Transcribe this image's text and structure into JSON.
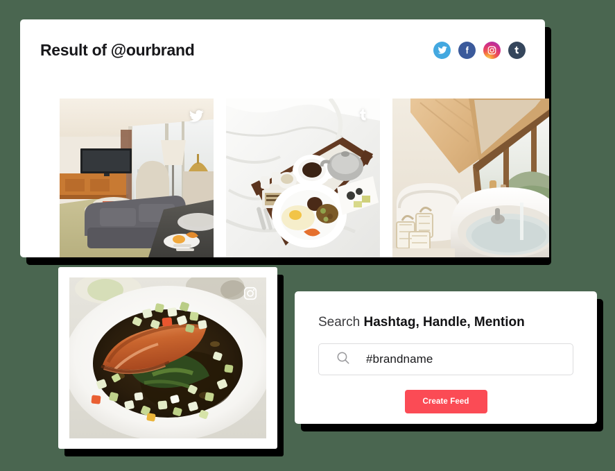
{
  "background_color": "#4a6650",
  "results_panel": {
    "title": "Result of @ourbrand",
    "social_icons": [
      {
        "name": "twitter-icon",
        "label": "Twitter",
        "color": "#43a8e0"
      },
      {
        "name": "facebook-icon",
        "label": "Facebook",
        "color": "#3b5a9b"
      },
      {
        "name": "instagram-icon",
        "label": "Instagram",
        "color": "#e23a6e"
      },
      {
        "name": "tumblr-icon",
        "label": "Tumblr",
        "color": "#35465c"
      }
    ],
    "thumbnails": [
      {
        "alt": "Hotel suite living room with city view",
        "source": "Twitter",
        "badge": "twitter-icon"
      },
      {
        "alt": "Breakfast tray in bed",
        "source": "Tumblr",
        "badge": "tumblr-icon"
      },
      {
        "alt": "Attic bathroom with bathtub",
        "source": "",
        "badge": ""
      }
    ]
  },
  "food_panel": {
    "alt": "Seared salmon fillet with diced vegetables",
    "source": "Instagram",
    "badge": "instagram-icon"
  },
  "search_panel": {
    "heading_light": "Search ",
    "heading_bold": "Hashtag, Handle, Mention",
    "input_value": "#brandname",
    "input_placeholder": "#brandname",
    "search_icon": "search-icon",
    "button_label": "Create Feed",
    "button_color": "#fb4b55"
  }
}
